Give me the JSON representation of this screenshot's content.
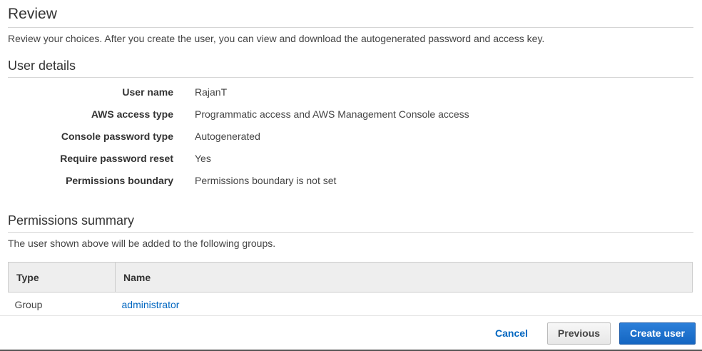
{
  "review": {
    "title": "Review",
    "description": "Review your choices. After you create the user, you can view and download the autogenerated password and access key."
  },
  "user_details": {
    "title": "User details",
    "rows": [
      {
        "label": "User name",
        "value": "RajanT"
      },
      {
        "label": "AWS access type",
        "value": "Programmatic access and AWS Management Console access"
      },
      {
        "label": "Console password type",
        "value": "Autogenerated"
      },
      {
        "label": "Require password reset",
        "value": "Yes"
      },
      {
        "label": "Permissions boundary",
        "value": "Permissions boundary is not set"
      }
    ]
  },
  "permissions": {
    "title": "Permissions summary",
    "description": "The user shown above will be added to the following groups.",
    "columns": {
      "type": "Type",
      "name": "Name"
    },
    "rows": [
      {
        "type": "Group",
        "name": "administrator"
      }
    ]
  },
  "footer": {
    "cancel_label": "Cancel",
    "previous_label": "Previous",
    "create_label": "Create user"
  },
  "colors": {
    "link": "#0066c0",
    "primary_button": "#1466c2"
  }
}
